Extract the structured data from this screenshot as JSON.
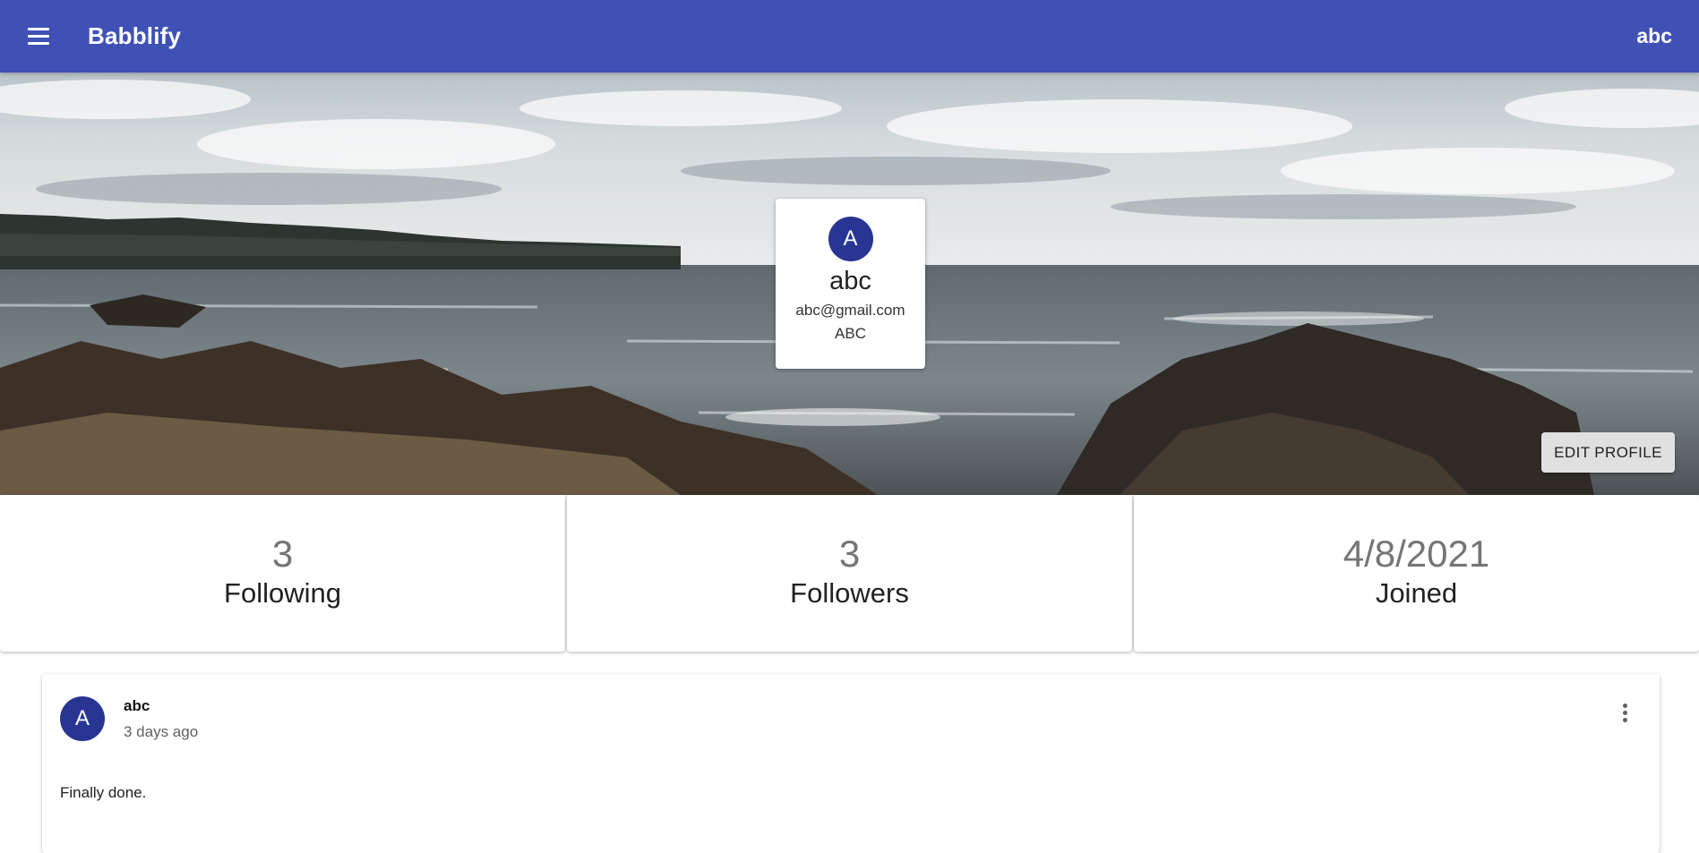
{
  "colors": {
    "primary": "#3f51b5",
    "avatar": "#283593",
    "button_bg": "#e0e0e0"
  },
  "appbar": {
    "menu_icon": "hamburger-menu-icon",
    "title": "Babblify",
    "user_label": "abc"
  },
  "hero": {
    "background": "coastal-seascape-photo"
  },
  "profile": {
    "avatar_letter": "A",
    "name": "abc",
    "email": "abc@gmail.com",
    "handle": "ABC",
    "edit_label": "EDIT PROFILE"
  },
  "stats": [
    {
      "value": "3",
      "label": "Following"
    },
    {
      "value": "3",
      "label": "Followers"
    },
    {
      "value": "4/8/2021",
      "label": "Joined"
    }
  ],
  "posts": [
    {
      "avatar_letter": "A",
      "author": "abc",
      "time": "3 days ago",
      "text": "Finally done.",
      "menu_icon": "more-vert-icon"
    }
  ]
}
